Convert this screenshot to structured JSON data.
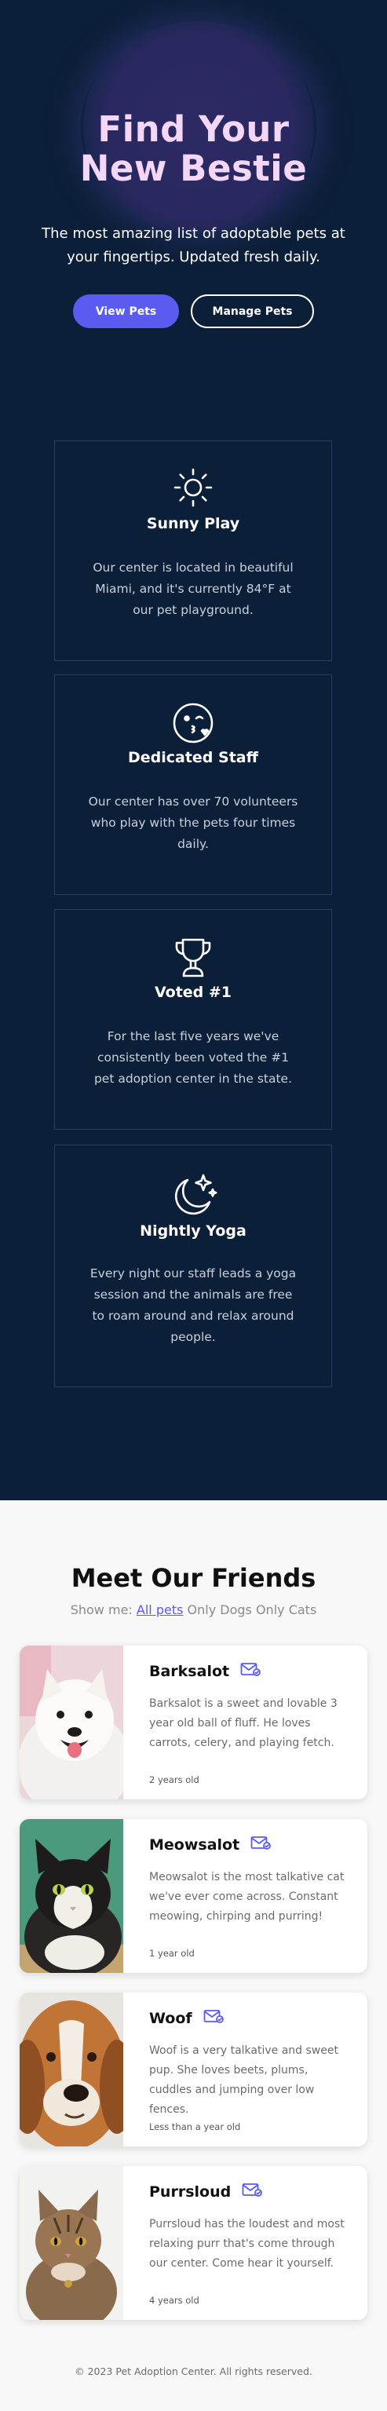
{
  "hero": {
    "title_line1": "Find Your",
    "title_line2": "New Bestie",
    "subtitle": "The most amazing list of adoptable pets at your fingertips. Updated fresh daily.",
    "view_pets": "View Pets",
    "manage_pets": "Manage Pets",
    "colors": {
      "title": "#f4d6f7",
      "background": "#0c1f38",
      "primary_button": "#5a5bf0"
    }
  },
  "stats": [
    {
      "icon": "sun-icon",
      "title": "Sunny Play",
      "text": "Our center is located in beautiful Miami, and it's currently 84°F at our pet playground."
    },
    {
      "icon": "kiss-face-icon",
      "title": "Dedicated Staff",
      "text": "Our center has over 70 volunteers who play with the pets four times daily."
    },
    {
      "icon": "trophy-icon",
      "title": "Voted #1",
      "text": "For the last five years we've consistently been voted the #1 pet adoption center in the state."
    },
    {
      "icon": "moon-stars-icon",
      "title": "Nightly Yoga",
      "text": "Every night our staff leads a yoga session and the animals are free to roam around and relax around people."
    }
  ],
  "friends": {
    "heading": "Meet Our Friends",
    "filter_label": "Show me:",
    "filters": [
      "All pets",
      "Only Dogs",
      "Only Cats"
    ],
    "active_filter": "All pets",
    "pets": [
      {
        "name": "Barksalot",
        "icon": "email-icon",
        "description": "Barksalot is a sweet and lovable 3 year old ball of fluff. He loves carrots, celery, and playing fetch.",
        "age": "2 years old"
      },
      {
        "name": "Meowsalot",
        "icon": "email-icon",
        "description": "Meowsalot is the most talkative cat we've ever come across. Constant meowing, chirping and purring!",
        "age": "1 year old"
      },
      {
        "name": "Woof",
        "icon": "email-icon",
        "description": "Woof is a very talkative and sweet pup. She loves beets, plums, cuddles and jumping over low fences.",
        "age": "Less than a year old"
      },
      {
        "name": "Purrsloud",
        "icon": "email-icon",
        "description": "Purrsloud has the loudest and most relaxing purr that's come through our center. Come hear it yourself.",
        "age": "4 years old"
      }
    ]
  },
  "footer": {
    "text": "© 2023 Pet Adoption Center. All rights reserved."
  }
}
